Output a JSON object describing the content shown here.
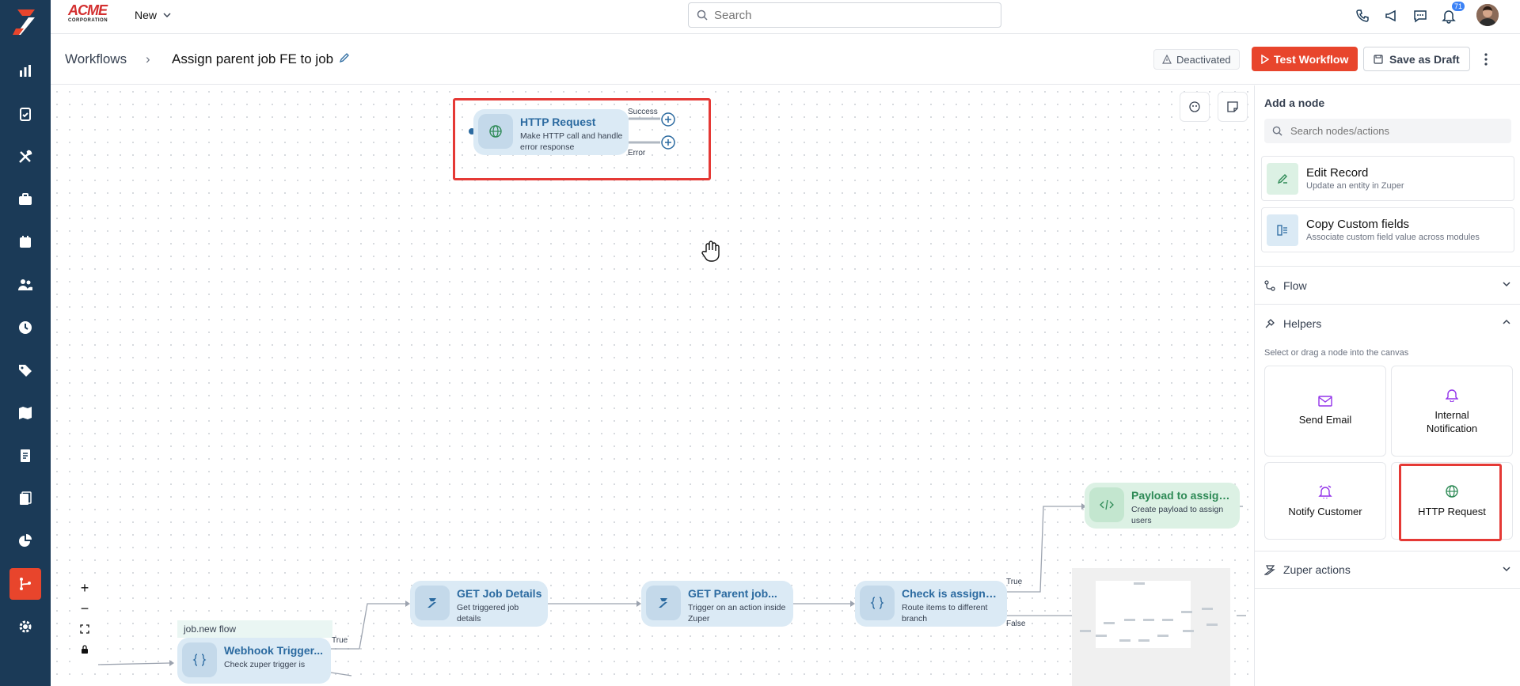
{
  "brand": {
    "name": "ACME",
    "sub": "CORPORATION"
  },
  "topbar": {
    "new_label": "New",
    "search_placeholder": "Search",
    "notification_count": "71"
  },
  "breadcrumb": {
    "root": "Workflows",
    "separator": "›",
    "current": "Assign parent job FE to job"
  },
  "status_badge": "Deactivated",
  "actions": {
    "test": "Test Workflow",
    "draft": "Save as Draft"
  },
  "canvas": {
    "http_node": {
      "title": "HTTP Request",
      "desc": "Make HTTP call and handle error response",
      "success": "Success",
      "error": "Error"
    },
    "nodes": [
      {
        "title": "Webhook Trigger...",
        "desc": "Check zuper trigger is"
      },
      {
        "title": "GET Job Details",
        "desc": "Get triggered job details"
      },
      {
        "title": "GET Parent job...",
        "desc": "Trigger on an action inside Zuper"
      },
      {
        "title": "Check is assigned...",
        "desc": "Route items to different branch"
      },
      {
        "title": "Payload to assign...",
        "desc": "Create payload to assign users"
      }
    ],
    "group_label": "job.new flow",
    "edge_labels": {
      "true1": "True",
      "true2": "True",
      "false1": "False"
    }
  },
  "panel": {
    "title": "Add a node",
    "search_placeholder": "Search nodes/actions",
    "cards": [
      {
        "title": "Edit Record",
        "desc": "Update an entity in Zuper"
      },
      {
        "title": "Copy Custom fields",
        "desc": "Associate custom field value across modules"
      }
    ],
    "sections": {
      "flow": "Flow",
      "helpers": "Helpers",
      "zuper": "Zuper actions"
    },
    "hint": "Select or drag a node into the canvas",
    "tiles": [
      {
        "label": "Send Email"
      },
      {
        "label": "Internal Notification"
      },
      {
        "label": "Notify Customer"
      },
      {
        "label": "HTTP Request"
      }
    ]
  },
  "colors": {
    "accent": "#e8452c",
    "sidebar": "#1b3a57",
    "highlight": "#e53935"
  },
  "icons": [
    "logo-icon",
    "dashboard-icon",
    "jobs-icon",
    "tools-icon",
    "briefcase-icon",
    "calendar-icon",
    "users-icon",
    "clock-icon",
    "tag-icon",
    "map-icon",
    "invoice-icon",
    "documents-icon",
    "reports-icon",
    "workflow-icon",
    "settings-icon"
  ]
}
